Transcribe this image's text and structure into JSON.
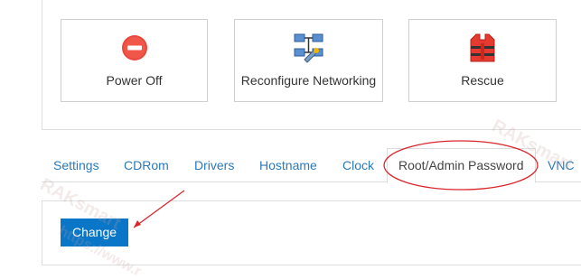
{
  "actions": [
    {
      "label": "Power Off",
      "icon": "power-off-icon"
    },
    {
      "label": "Reconfigure Networking",
      "icon": "network-icon"
    },
    {
      "label": "Rescue",
      "icon": "life-vest-icon"
    }
  ],
  "tabs": {
    "settings": "Settings",
    "cdrom": "CDRom",
    "drivers": "Drivers",
    "hostname": "Hostname",
    "clock": "Clock",
    "root_password": "Root/Admin Password",
    "vnc": "VNC"
  },
  "active_tab": "Root/Admin Password",
  "change_button": "Change",
  "watermark": {
    "brand": "RAKsmart",
    "url": "https://www.r"
  },
  "colors": {
    "accent": "#0a76c8",
    "tab_link": "#2a7ab8",
    "annotation": "#d9262c"
  }
}
